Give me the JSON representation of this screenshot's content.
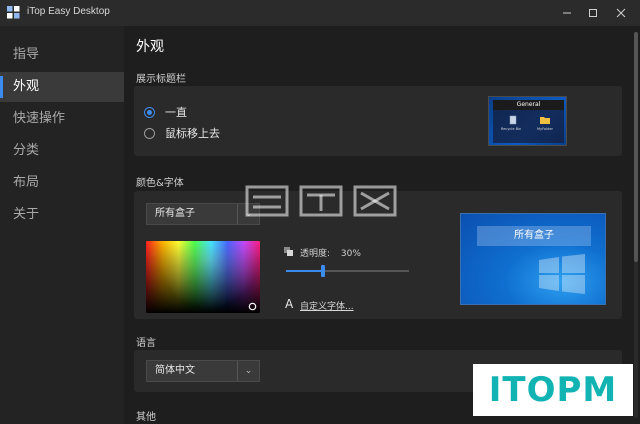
{
  "window": {
    "title": "iTop Easy Desktop"
  },
  "sidebar": {
    "items": [
      {
        "label": "指导",
        "active": false
      },
      {
        "label": "外观",
        "active": true
      },
      {
        "label": "快速操作",
        "active": false
      },
      {
        "label": "分类",
        "active": false
      },
      {
        "label": "布局",
        "active": false
      },
      {
        "label": "关于",
        "active": false
      }
    ]
  },
  "main": {
    "title": "外观",
    "title_bar_section": {
      "label": "展示标题栏",
      "options": [
        {
          "label": "一直",
          "checked": true
        },
        {
          "label": "鼠标移上去",
          "checked": false
        }
      ],
      "preview": {
        "header": "General",
        "items": [
          "Recycle Bin",
          "MyFolder"
        ]
      }
    },
    "color_font_section": {
      "label": "颜色&字体",
      "box_select": "所有盒子",
      "opacity_label": "透明度:",
      "opacity_value": "30%",
      "opacity_fraction": 0.3,
      "custom_font_link": "自定义字体...",
      "preview_box_title": "所有盒子",
      "accent_color": "#3c8cf0"
    },
    "language_section": {
      "label": "语言",
      "selected": "简体中文"
    },
    "other_section": {
      "label": "其他"
    }
  },
  "watermark": {
    "brand": "ITOPM"
  }
}
